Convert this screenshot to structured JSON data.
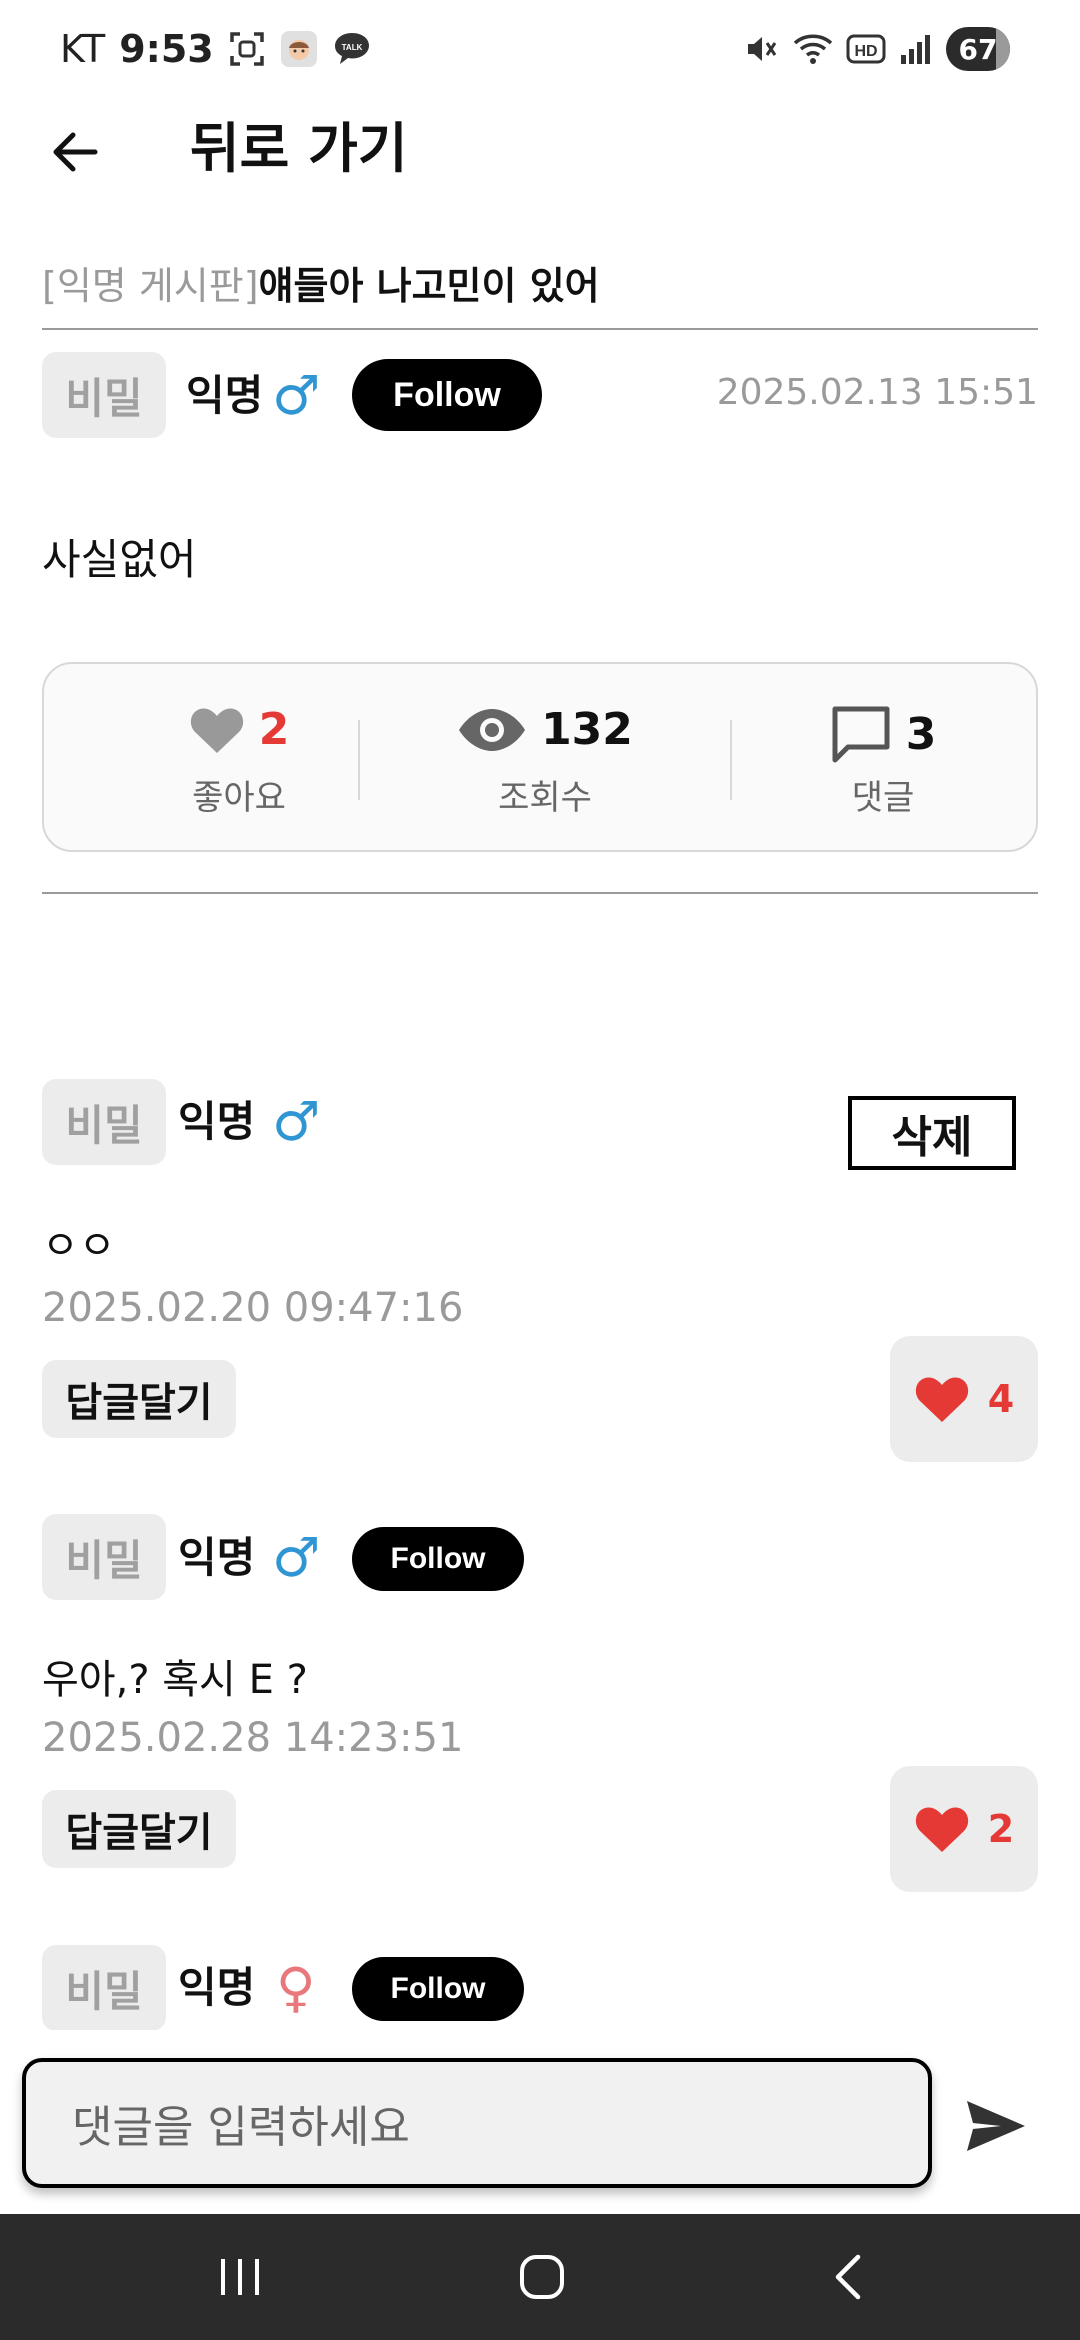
{
  "status_bar": {
    "carrier": "KT",
    "time": "9:53",
    "talk_label": "TALK",
    "hd_label": "HD",
    "battery": "67",
    "icons": [
      "screenshot-icon",
      "avatar-icon",
      "talk-icon",
      "mute-icon",
      "wifi-icon",
      "hd-icon",
      "signal-icon",
      "battery-icon"
    ]
  },
  "header": {
    "title": "뒤로 가기",
    "back_icon": "arrow-left-icon"
  },
  "post": {
    "board": "[익명 게시판]",
    "title": "얘들아 나고민이 있어",
    "secret_badge": "비밀",
    "author": "익명",
    "gender": "♂",
    "follow": "Follow",
    "date": "2025.02.13 15:51",
    "body": "사실없어"
  },
  "stats": {
    "likes": {
      "count": "2",
      "label": "좋아요",
      "icon": "heart-icon"
    },
    "views": {
      "count": "132",
      "label": "조회수",
      "icon": "eye-icon"
    },
    "comments": {
      "count": "3",
      "label": "댓글",
      "icon": "comment-icon"
    }
  },
  "comments": [
    {
      "secret_badge": "비밀",
      "author": "익명",
      "gender": "♂",
      "delete": "삭제",
      "text": "ㅇㅇ",
      "date": "2025.02.20 09:47:16",
      "reply": "답글달기",
      "likes": "4"
    },
    {
      "secret_badge": "비밀",
      "author": "익명",
      "gender": "♂",
      "follow": "Follow",
      "text": "우아,? 혹시 E ?",
      "date": "2025.02.28 14:23:51",
      "reply": "답글달기",
      "likes": "2"
    },
    {
      "secret_badge": "비밀",
      "author": "익명",
      "gender": "♀",
      "follow": "Follow"
    }
  ],
  "input": {
    "placeholder": "댓글을 입력하세요",
    "send_icon": "send-icon"
  },
  "nav": {
    "icons": [
      "recents-icon",
      "home-icon",
      "back-icon"
    ]
  },
  "colors": {
    "accent_red": "#e53935",
    "male_blue": "#2f96d3",
    "female_pink": "#e8787b",
    "muted_gray": "#9a9a9a",
    "nav_bg": "#2b2b2b"
  }
}
